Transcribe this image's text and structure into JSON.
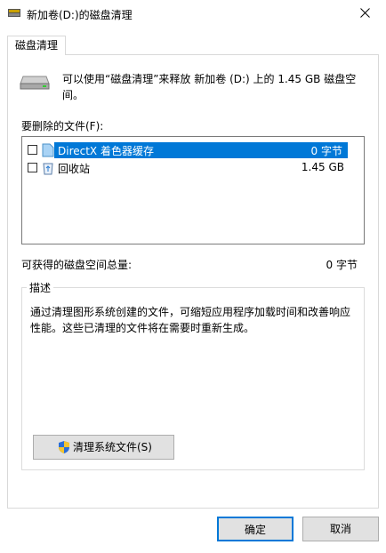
{
  "window": {
    "title": "新加卷(D:)的磁盘清理"
  },
  "tab": {
    "label": "磁盘清理"
  },
  "summary": {
    "text": "可以使用“磁盘清理”来释放 新加卷 (D:) 上的 1.45 GB 磁盘空间。"
  },
  "files": {
    "label": "要删除的文件(F):",
    "items": [
      {
        "name": "DirectX 着色器缓存",
        "size": "0 字节",
        "checked": false,
        "selected": true,
        "icon": "file-icon"
      },
      {
        "name": "回收站",
        "size": "1.45 GB",
        "checked": false,
        "selected": false,
        "icon": "recycle-bin-icon"
      }
    ]
  },
  "total": {
    "label": "可获得的磁盘空间总量:",
    "value": "0 字节"
  },
  "description": {
    "title": "描述",
    "text": "通过清理图形系统创建的文件，可缩短应用程序加载时间和改善响应性能。这些已清理的文件将在需要时重新生成。"
  },
  "buttons": {
    "clean_system": "清理系统文件(S)",
    "ok": "确定",
    "cancel": "取消"
  },
  "colors": {
    "selection": "#0078d7",
    "button_face": "#e1e1e1"
  }
}
